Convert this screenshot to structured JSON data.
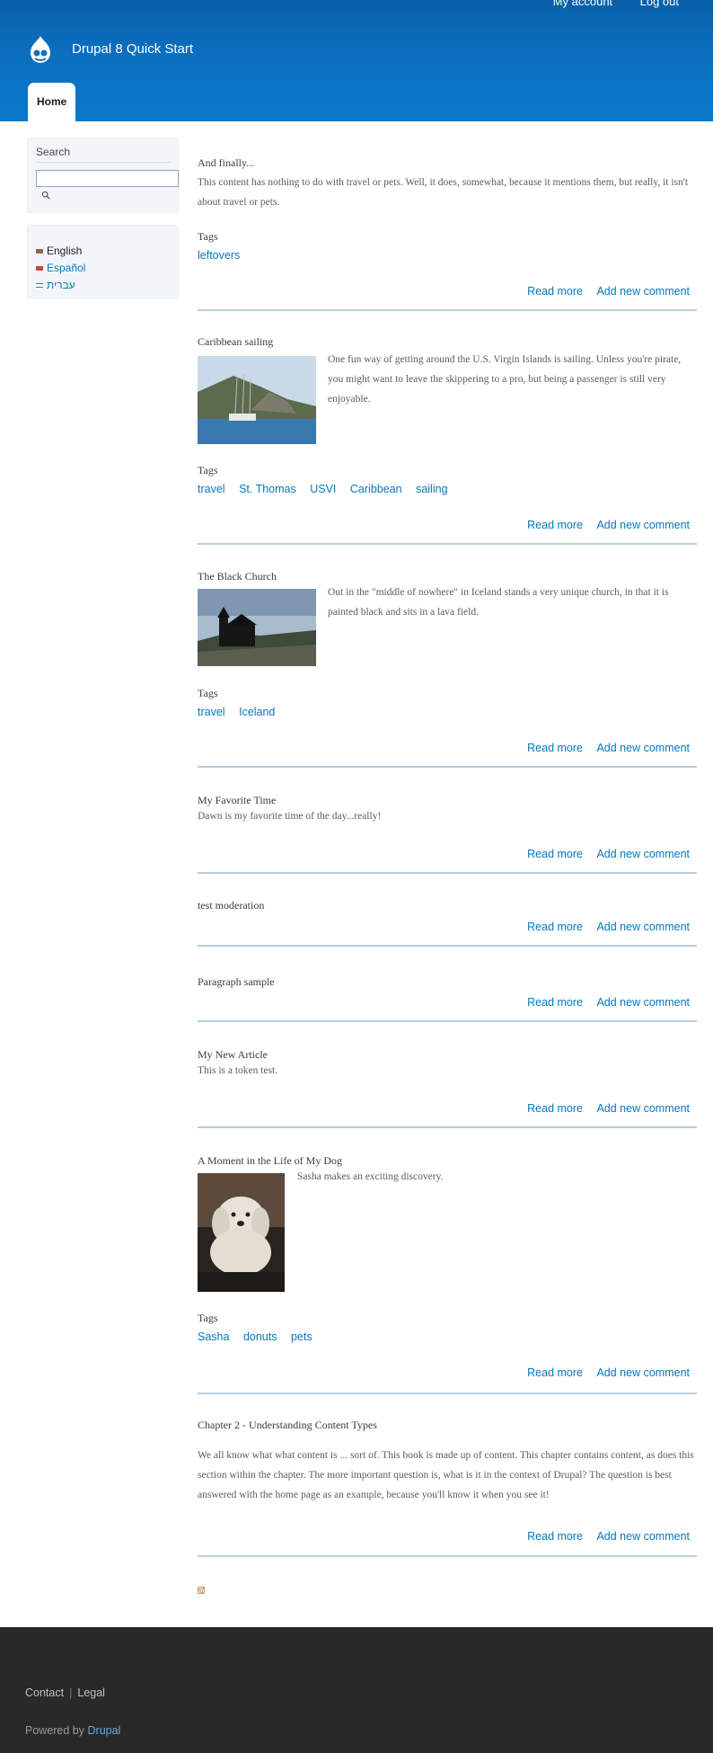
{
  "header": {
    "secondary_menu": [
      {
        "label": "My account"
      },
      {
        "label": "Log out"
      }
    ],
    "site_name": "Drupal 8 Quick Start",
    "main_menu": [
      {
        "label": "Home"
      }
    ]
  },
  "sidebar": {
    "search": {
      "title": "Search",
      "input_value": "",
      "button_icon": "search-icon"
    },
    "languages": [
      {
        "label": "English",
        "active": true,
        "flag_color": "#8a6a4a"
      },
      {
        "label": "Español",
        "active": false,
        "flag_color": "#c9463d"
      },
      {
        "label": "עברית",
        "active": false,
        "flag_color": "#3a6fb5"
      }
    ]
  },
  "articles": [
    {
      "title": "And finally...",
      "body": "This content has nothing to do with travel or pets. Well, it does, somewhat, because it mentions them, but really, it isn't about travel or pets.",
      "tags_label": "Tags",
      "tags": [
        "leftovers"
      ],
      "read_more": "Read more",
      "add_comment": "Add new comment"
    },
    {
      "title": "Caribbean sailing",
      "body": "One fun way of getting around the U.S. Virgin Islands is sailing. Unless you're pirate, you might want to leave the skippering to a pro, but being a passenger is still very enjoyable.",
      "tags_label": "Tags",
      "tags": [
        "travel",
        "St. Thomas",
        "USVI",
        "Caribbean",
        "sailing"
      ],
      "read_more": "Read more",
      "add_comment": "Add new comment"
    },
    {
      "title": "The Black Church",
      "body": "Out in the \"middle of nowhere\" in Iceland stands a very unique church, in that it is painted  black and sits in a lava field.",
      "tags_label": "Tags",
      "tags": [
        "travel",
        "Iceland"
      ],
      "read_more": "Read more",
      "add_comment": "Add new comment"
    },
    {
      "title": "My Favorite Time",
      "body": "Dawn is my favorite time of the day...really!",
      "read_more": "Read more",
      "add_comment": "Add new comment"
    },
    {
      "title": "test moderation",
      "read_more": "Read more",
      "add_comment": "Add new comment"
    },
    {
      "title": "Paragraph sample",
      "read_more": "Read more",
      "add_comment": "Add new comment"
    },
    {
      "title": "My New Article",
      "body": "This is a token test.",
      "read_more": "Read more",
      "add_comment": "Add new comment"
    },
    {
      "title": "A Moment in the Life of My Dog",
      "body": "Sasha makes an exciting discovery.",
      "tags_label": "Tags",
      "tags": [
        "Sasha",
        "donuts",
        "pets"
      ],
      "read_more": "Read more",
      "add_comment": "Add new comment"
    },
    {
      "title": "Chapter 2 - Understanding Content Types",
      "body": "We all know what what content is ... sort of. This book is made up of content. This chapter contains content, as does this section within the chapter. The more important question is, what is it in the context of Drupal? The question is best answered with the home page as an example, because you'll know it when you see it!",
      "read_more": "Read more",
      "add_comment": "Add new comment"
    }
  ],
  "feed_icon": "rss-icon",
  "footer": {
    "menu": [
      {
        "label": "Contact"
      },
      {
        "label": "Legal"
      }
    ],
    "powered_prefix": "Powered by",
    "powered_link": "Drupal"
  },
  "colors": {
    "header_blue": "#0a6fbd",
    "link_blue": "#0678be",
    "footer_bg": "#292929",
    "divider": "#b9cce0"
  }
}
